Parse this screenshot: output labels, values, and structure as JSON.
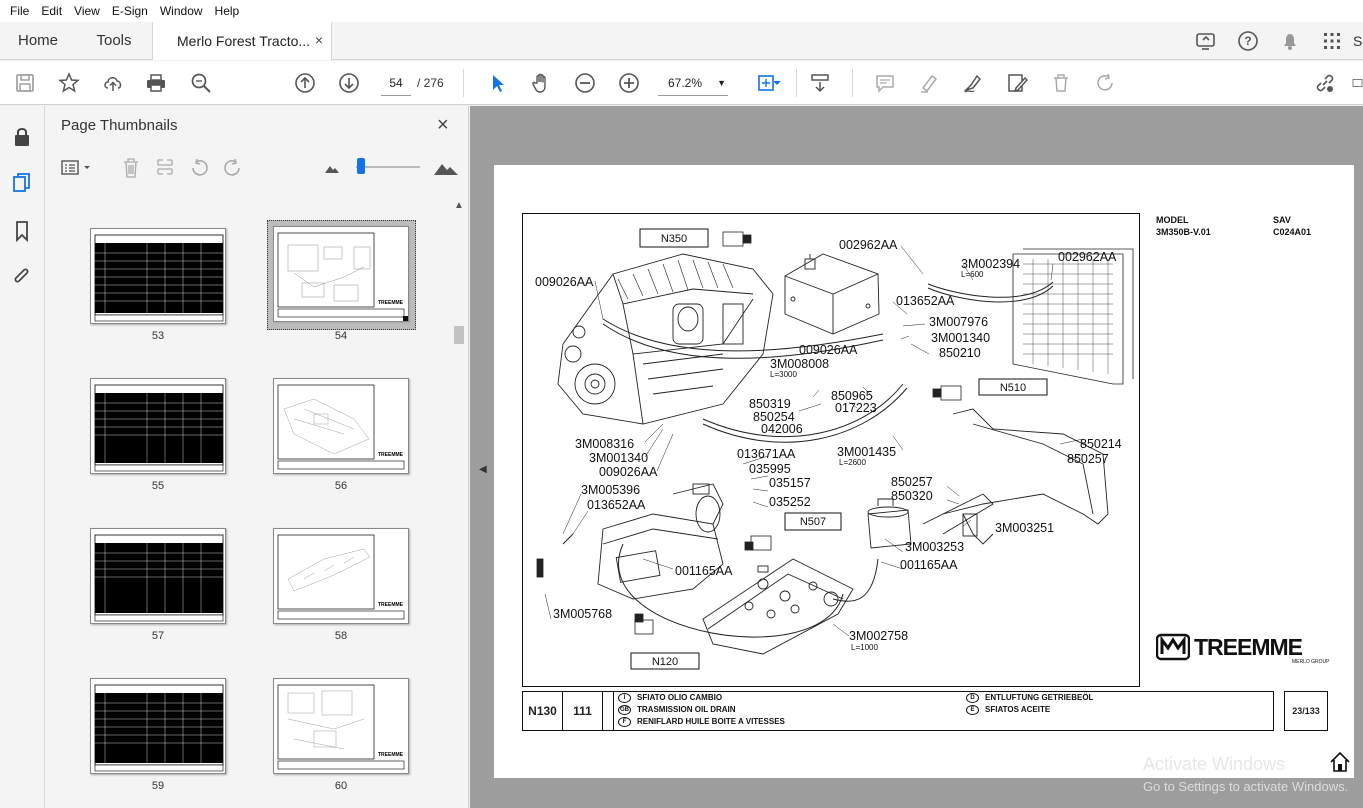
{
  "menu": [
    "File",
    "Edit",
    "View",
    "E-Sign",
    "Window",
    "Help"
  ],
  "tabs": {
    "home": "Home",
    "tools": "Tools",
    "document": "Merlo Forest Tracto...",
    "close": "×",
    "signin_partial": "S"
  },
  "toolbar": {
    "page_current": "54",
    "page_total": "/ 276",
    "zoom": "67.2%",
    "zoom_caret": "▼"
  },
  "panel": {
    "title": "Page Thumbnails",
    "close": "×",
    "thumbnails": [
      "53",
      "54",
      "55",
      "56",
      "57",
      "58",
      "59",
      "60"
    ],
    "selected": "54"
  },
  "document_page": {
    "model_label": "MODEL",
    "model_value": "3M350B-V.01",
    "sav_label": "SAV",
    "sav_value": "C024A01",
    "boxes": [
      "N350",
      "N510",
      "N507",
      "N120"
    ],
    "part_labels": [
      "002962AA",
      "3M002394",
      "L=600",
      "002962AA",
      "013652AA",
      "3M007976",
      "3M001340",
      "850210",
      "009026AA",
      "009026AA",
      "3M008008",
      "L=3000",
      "850965",
      "017223",
      "850319",
      "850254",
      "042006",
      "3M008316",
      "3M001340",
      "009026AA",
      "3M001435",
      "L=2600",
      "850214",
      "850257",
      "013671AA",
      "035995",
      "035157",
      "035252",
      "3M005396",
      "013652AA",
      "850257",
      "850320",
      "3M003251",
      "3M003253",
      "001165AA",
      "001165AA",
      "3M005768",
      "3M002758",
      "L=1000"
    ],
    "title_block": {
      "group": "N130",
      "table": "111",
      "desc_i": "SFIATO OLIO CAMBIO",
      "desc_gb": "TRASMISSION OIL DRAIN",
      "desc_f": "RENIFLARD HUILE BOITE A VITESSES",
      "desc_d": "ENTLUFTUNG GETRIEBEÖL",
      "desc_e": "SFIATOS ACEITE",
      "lang_i": "I",
      "lang_gb": "GB",
      "lang_f": "F",
      "lang_d": "D",
      "lang_e": "E",
      "sheet": "23/133"
    },
    "brand": "TREEMME",
    "brand_sub": "MERLO GROUP"
  },
  "watermark": {
    "line1": "Activate Windows",
    "line2": "Go to Settings to activate Windows."
  },
  "colors": {
    "accent": "#1473e6",
    "toolbar_bg": "#ffffff",
    "panel_bg": "#f4f4f4",
    "doc_bg": "#9d9d9d"
  },
  "icons": [
    "save-icon",
    "star-icon",
    "upload-icon",
    "print-icon",
    "search-zoom-icon",
    "arrow-up-icon",
    "arrow-down-icon",
    "cursor-icon",
    "hand-icon",
    "zoom-out-icon",
    "zoom-in-icon",
    "fit-page-icon",
    "scroll-mode-icon",
    "comment-icon",
    "highlight-icon",
    "sign-icon",
    "edit-icon",
    "delete-icon",
    "redo-icon",
    "share-link-icon"
  ]
}
